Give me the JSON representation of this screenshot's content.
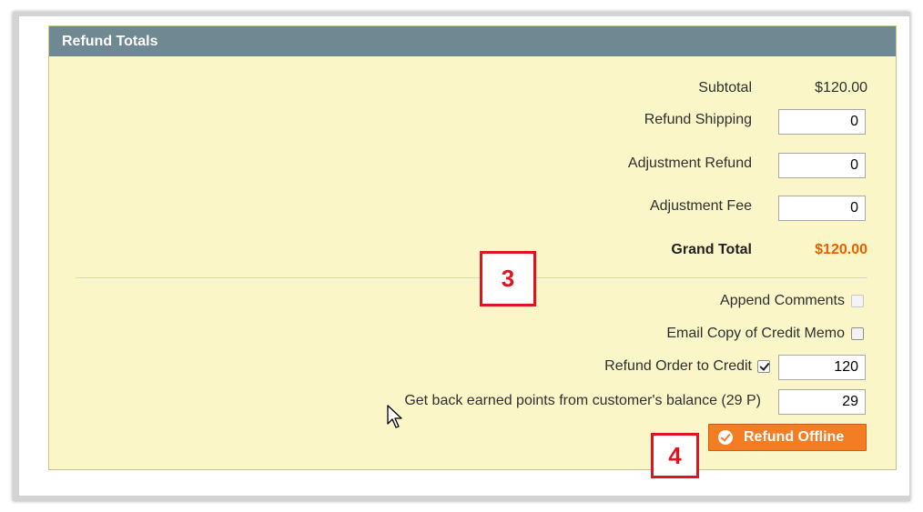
{
  "panel": {
    "title": "Refund Totals"
  },
  "totals": {
    "subtotal_label": "Subtotal",
    "subtotal_value": "$120.00",
    "refund_shipping_label": "Refund Shipping",
    "refund_shipping_value": "0",
    "adjustment_refund_label": "Adjustment Refund",
    "adjustment_refund_value": "0",
    "adjustment_fee_label": "Adjustment Fee",
    "adjustment_fee_value": "0",
    "grand_total_label": "Grand Total",
    "grand_total_value": "$120.00"
  },
  "options": {
    "append_comments_label": "Append Comments",
    "append_comments_checked": false,
    "email_copy_label": "Email Copy of Credit Memo",
    "email_copy_checked": false,
    "refund_to_credit_label": "Refund Order to Credit",
    "refund_to_credit_checked": true,
    "refund_to_credit_value": "120",
    "points_label": "Get back earned points from customer's balance (29 P)",
    "points_value": "29"
  },
  "actions": {
    "refund_offline_label": "Refund Offline"
  },
  "callouts": {
    "step3": "3",
    "step4": "4"
  },
  "colors": {
    "header_bg": "#6f8992",
    "panel_bg": "#fbf6c8",
    "grand_total": "#eb5e00",
    "button": "#f47d23",
    "callout": "#e0141f"
  },
  "icons": {
    "button_icon": "check-circle-icon",
    "cursor": "mouse-pointer-icon"
  }
}
